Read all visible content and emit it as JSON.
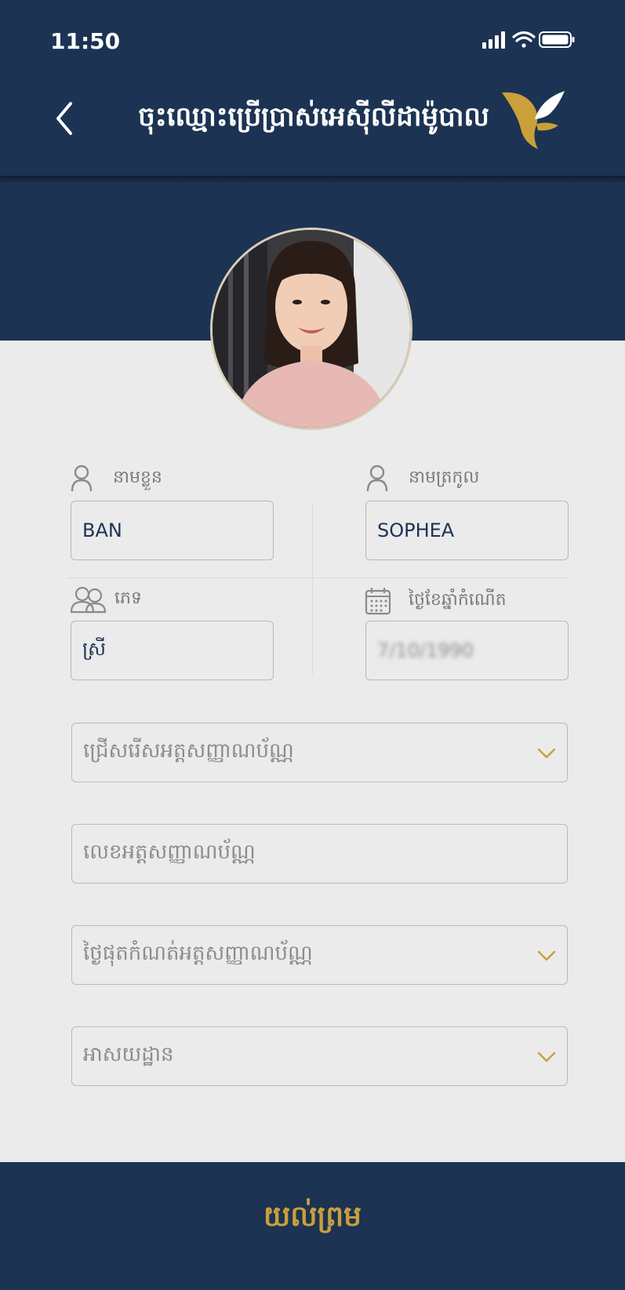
{
  "status_bar": {
    "time": "11:50",
    "icons": [
      "signal-icon",
      "wifi-icon",
      "battery-icon"
    ]
  },
  "header": {
    "title": "ចុះឈ្មោះប្រើប្រាស់អេស៊ីលីដាម៉ូបាល",
    "back_icon": "chevron-left-icon",
    "logo_icon": "bird-logo-icon"
  },
  "form": {
    "first_name": {
      "label": "នាមខ្លួន",
      "value": "BAN"
    },
    "last_name": {
      "label": "នាមត្រកូល",
      "value": "SOPHEA"
    },
    "gender": {
      "label": "ភេទ",
      "value": "ស្រី"
    },
    "dob": {
      "label": "ថ្ងៃខែឆ្នាំកំណើត",
      "value": "7/10/1990"
    },
    "id_type": {
      "placeholder": "ជ្រើសរើសអត្តសញ្ញាណប័ណ្ណ"
    },
    "id_number": {
      "placeholder": "លេខអត្តសញ្ញាណប័ណ្ណ"
    },
    "id_expiry": {
      "placeholder": "ថ្ងៃផុតកំណត់អត្តសញ្ញាណប័ណ្ណ"
    },
    "address": {
      "placeholder": "អាសយដ្ឋាន"
    }
  },
  "footer": {
    "agree_label": "យល់ព្រម"
  },
  "colors": {
    "navy": "#1c3353",
    "gold": "#c9a03a",
    "background": "#ebebeb"
  }
}
